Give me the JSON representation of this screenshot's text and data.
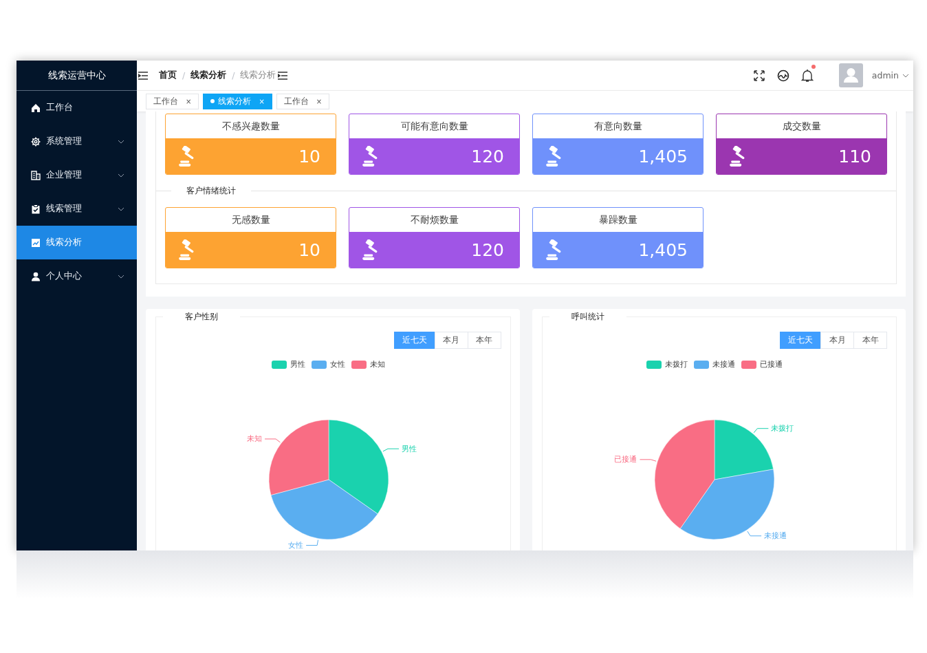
{
  "sidebar": {
    "title": "线索运营中心",
    "items": [
      {
        "label": "工作台",
        "expandable": false,
        "selected": false
      },
      {
        "label": "系统管理",
        "expandable": true,
        "selected": false
      },
      {
        "label": "企业管理",
        "expandable": true,
        "selected": false
      },
      {
        "label": "线索管理",
        "expandable": true,
        "selected": false
      },
      {
        "label": "线索分析",
        "expandable": false,
        "selected": true
      },
      {
        "label": "个人中心",
        "expandable": true,
        "selected": false
      }
    ]
  },
  "header": {
    "separator": "/",
    "breadcrumb": [
      {
        "label": "首页",
        "current": false
      },
      {
        "label": "线索分析",
        "current": false
      },
      {
        "label": "线索分析",
        "current": true
      }
    ],
    "user": "admin",
    "notification": {
      "unread": true
    }
  },
  "tabs": [
    {
      "label": "工作台",
      "close": "×",
      "selected": false
    },
    {
      "label": "线索分析",
      "close": "×",
      "selected": true
    },
    {
      "label": "工作台",
      "close": "×",
      "selected": false
    }
  ],
  "stat_groups": [
    {
      "cards": [
        {
          "title": "不感兴趣数量",
          "value": "10",
          "color": "#fda332"
        },
        {
          "title": "可能有意向数量",
          "value": "120",
          "color": "#a055e6"
        },
        {
          "title": "有意向数量",
          "value": "1,405",
          "color": "#6f91fb"
        },
        {
          "title": "成交数量",
          "value": "110",
          "color": "#9b36b0"
        }
      ]
    },
    {
      "title": "客户情绪统计",
      "cards": [
        {
          "title": "无感数量",
          "value": "10",
          "color": "#fda332"
        },
        {
          "title": "不耐烦数量",
          "value": "120",
          "color": "#a055e6"
        },
        {
          "title": "暴躁数量",
          "value": "1,405",
          "color": "#6f91fb"
        }
      ]
    }
  ],
  "charts": [
    {
      "title": "客户性别",
      "ranges": [
        {
          "label": "近七天",
          "selected": true
        },
        {
          "label": "本月",
          "selected": false
        },
        {
          "label": "本年",
          "selected": false
        }
      ],
      "series": [
        {
          "legend": "男性",
          "label": "男性",
          "color": "#1ad2ae"
        },
        {
          "legend": "女性",
          "label": "女性",
          "color": "#5aaef0"
        },
        {
          "legend": "未知",
          "label": "未知",
          "color": "#f96d84"
        }
      ]
    },
    {
      "title": "呼叫统计",
      "ranges": [
        {
          "label": "近七天",
          "selected": true
        },
        {
          "label": "本月",
          "selected": false
        },
        {
          "label": "本年",
          "selected": false
        }
      ],
      "series": [
        {
          "legend": "未拨打",
          "label": "未拨打",
          "color": "#1ad2ae"
        },
        {
          "legend": "未接通",
          "label": "未接通",
          "color": "#5aaef0"
        },
        {
          "legend": "已接通",
          "label": "已接通",
          "color": "#f96d84"
        }
      ]
    }
  ]
}
